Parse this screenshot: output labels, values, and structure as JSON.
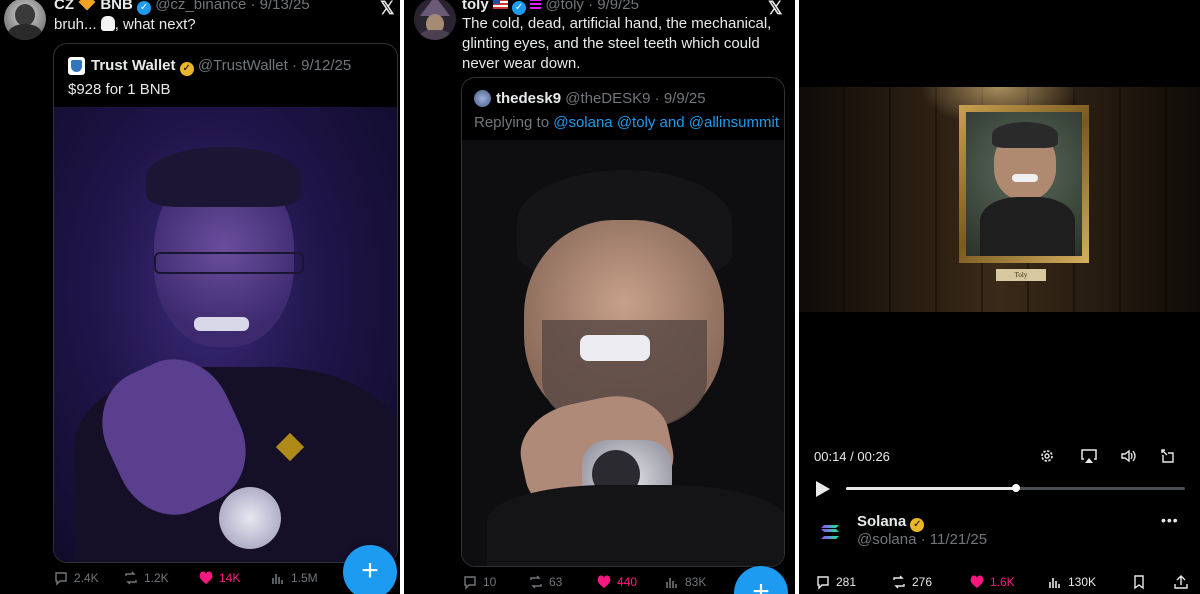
{
  "post1": {
    "display_name": "CZ",
    "name_suffix": "BNB",
    "handle": "@cz_binance",
    "date": "9/13/25",
    "text_before_emoji": "bruh... ",
    "text_after_emoji": ", what next?",
    "quote": {
      "display_name": "Trust Wallet",
      "handle": "@TrustWallet",
      "date": "9/12/25",
      "text": "$928 for 1 BNB"
    },
    "stats": {
      "replies": "2.4K",
      "reposts": "1.2K",
      "likes": "14K",
      "views": "1.5M"
    },
    "compose_label": "+"
  },
  "post2": {
    "display_name": "toly",
    "handle": "@toly",
    "date": "9/9/25",
    "text": "The cold, dead, artificial hand, the mechanical, glinting eyes, and the steel teeth which could never wear down.",
    "quote": {
      "display_name": "thedesk9",
      "handle": "@theDESK9",
      "date": "9/9/25",
      "replying_prefix": "Replying to",
      "replying_to": "@solana @toly and @allinsummit"
    },
    "stats": {
      "replies": "10",
      "reposts": "63",
      "likes": "440",
      "views": "83K"
    },
    "compose_label": "+"
  },
  "post3": {
    "portrait_plaque": "Toly",
    "video_time": "00:14 / 00:26",
    "video_progress": 0.5,
    "display_name": "Solana",
    "handle": "@solana",
    "date": "11/21/25",
    "more_label": "•••",
    "stats": {
      "replies": "281",
      "reposts": "276",
      "likes": "1.6K",
      "views": "130K"
    }
  },
  "separator": "·",
  "x_logo": "𝕏",
  "colors": {
    "background": "#000000",
    "text": "#e7e9ea",
    "muted": "#71767b",
    "link": "#1d9bf0",
    "like": "#f91880",
    "verified_blue": "#1d9bf0",
    "verified_gold": "#e8b628"
  }
}
